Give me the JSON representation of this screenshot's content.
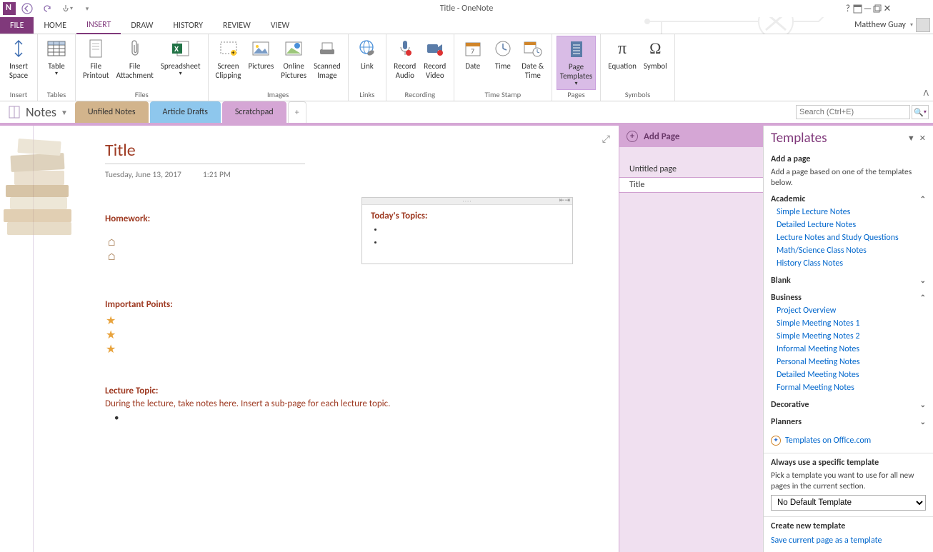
{
  "titlebar": {
    "title": "Title - OneNote",
    "user": "Matthew Guay"
  },
  "tabs": {
    "file": "FILE",
    "home": "HOME",
    "insert": "INSERT",
    "draw": "DRAW",
    "history": "HISTORY",
    "review": "REVIEW",
    "view": "VIEW"
  },
  "ribbon": {
    "groups": {
      "insert": {
        "label": "Insert",
        "space": "Insert\nSpace"
      },
      "tables": {
        "label": "Tables",
        "table": "Table"
      },
      "files": {
        "label": "Files",
        "printout": "File\nPrintout",
        "attachment": "File\nAttachment",
        "spreadsheet": "Spreadsheet"
      },
      "images": {
        "label": "Images",
        "clipping": "Screen\nClipping",
        "pictures": "Pictures",
        "online": "Online\nPictures",
        "scanned": "Scanned\nImage"
      },
      "links": {
        "label": "Links",
        "link": "Link"
      },
      "recording": {
        "label": "Recording",
        "audio": "Record\nAudio",
        "video": "Record\nVideo"
      },
      "timestamp": {
        "label": "Time Stamp",
        "date": "Date",
        "time": "Time",
        "datetime": "Date &\nTime"
      },
      "pages": {
        "label": "Pages",
        "templates": "Page\nTemplates"
      },
      "symbols": {
        "label": "Symbols",
        "equation": "Equation",
        "symbol": "Symbol"
      }
    }
  },
  "notebook": {
    "name": "Notes"
  },
  "sections": {
    "t1": "Unfiled Notes",
    "t2": "Article Drafts",
    "t3": "Scratchpad"
  },
  "search": {
    "placeholder": "Search (Ctrl+E)"
  },
  "pages_pane": {
    "add": "Add Page",
    "items": [
      "Untitled page",
      "Title"
    ],
    "selected_index": 1
  },
  "page": {
    "title": "Title",
    "date": "Tuesday, June 13, 2017",
    "time": "1:21 PM",
    "headings": {
      "homework": "Homework:",
      "important": "Important Points:",
      "lecture": "Lecture Topic:",
      "todays": "Today's Topics:"
    },
    "lecture_body": "During the lecture, take notes here.  Insert a sub-page for each lecture topic."
  },
  "templates": {
    "title": "Templates",
    "add_page_h": "Add a page",
    "add_page_desc": "Add a page based on one of the templates below.",
    "cats": {
      "academic": "Academic",
      "blank": "Blank",
      "business": "Business",
      "decorative": "Decorative",
      "planners": "Planners"
    },
    "academic_items": [
      "Simple Lecture Notes",
      "Detailed Lecture Notes",
      "Lecture Notes and Study Questions",
      "Math/Science Class Notes",
      "History Class Notes"
    ],
    "business_items": [
      "Project Overview",
      "Simple Meeting Notes 1",
      "Simple Meeting Notes 2",
      "Informal Meeting Notes",
      "Personal Meeting Notes",
      "Detailed Meeting Notes",
      "Formal Meeting Notes"
    ],
    "office_link": "Templates on Office.com",
    "always_h": "Always use a specific template",
    "always_desc": "Pick a template you want to use for all new pages in the current section.",
    "select_default": "No Default Template",
    "create_h": "Create new template",
    "save_link": "Save current page as a template"
  }
}
